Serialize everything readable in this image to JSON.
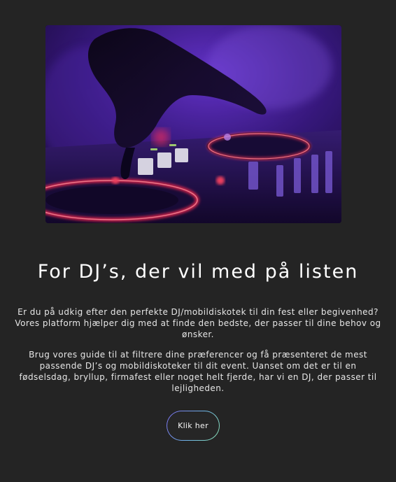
{
  "hero": {
    "image": "dj-hand-on-controller-purple-lights"
  },
  "heading": "For DJ’s, der vil med på listen",
  "paragraphs": [
    "Er du på udkig efter den perfekte DJ/mobildiskotek til din fest eller begivenhed? Vores platform hjælper dig med at finde den bedste, der passer til dine behov og ønsker.",
    "Brug vores guide til at filtrere dine præferencer og få præsenteret de mest passende DJ’s og mobildiskoteker til dit event. Uanset om det er til en fødselsdag, bryllup, firmafest eller noget helt fjerde, har vi en DJ, der passer til lejligheden."
  ],
  "cta": {
    "label": "Klik her"
  },
  "colors": {
    "background": "#242424",
    "text": "#ffffff",
    "button_border_start": "#7b6cf0",
    "button_border_end": "#8be3b0",
    "hero_purple": "#6a2fd1",
    "hero_red": "#ff2a55"
  }
}
